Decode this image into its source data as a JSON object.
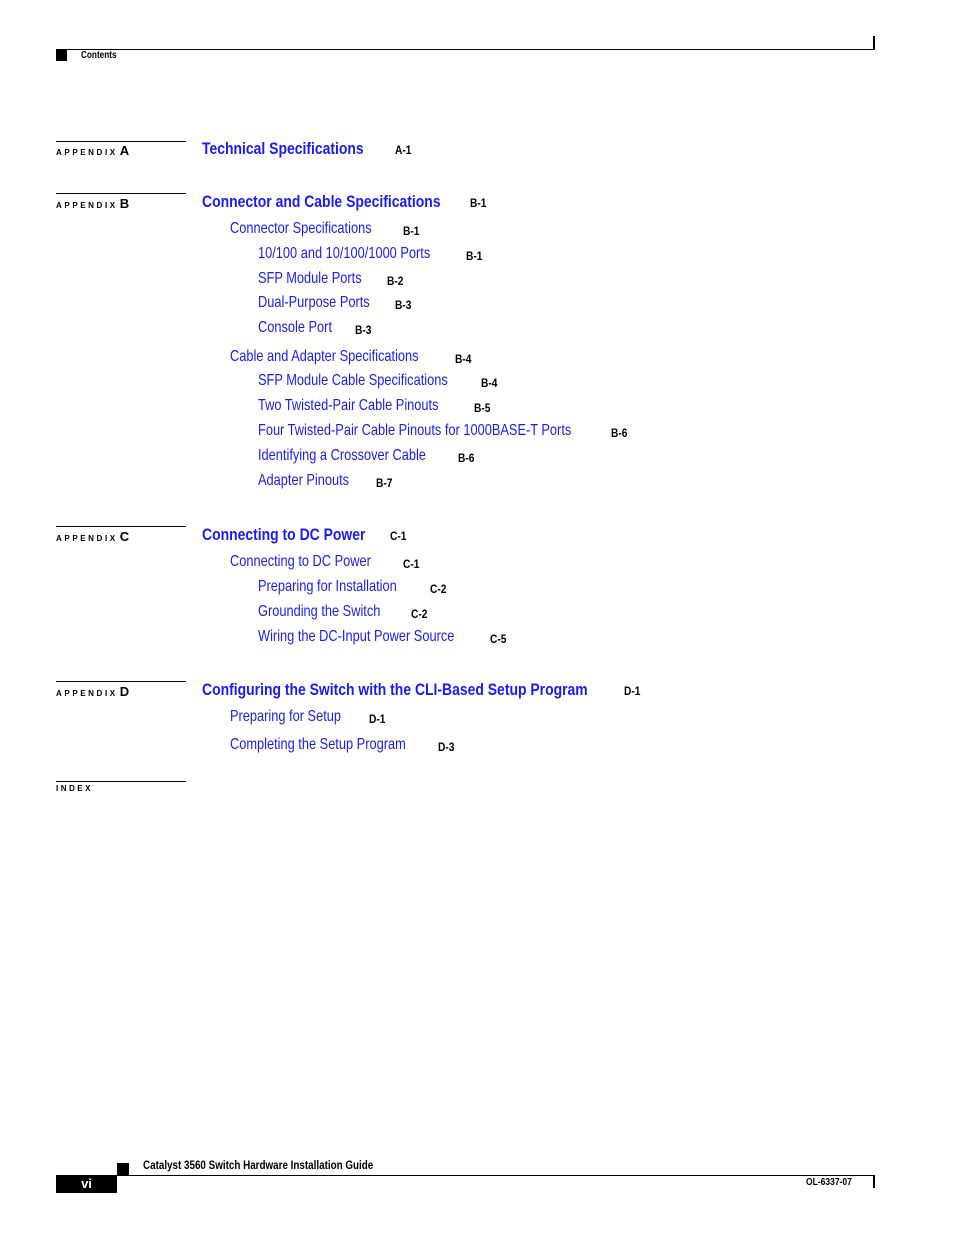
{
  "header": {
    "section": "Contents"
  },
  "colors": {
    "link": "#1a1aff",
    "text": "#000000"
  },
  "appendices": [
    {
      "tag": "APPENDIX",
      "letter": "A",
      "title": "Technical Specifications",
      "page": "A-1",
      "entries": []
    },
    {
      "tag": "APPENDIX",
      "letter": "B",
      "title": "Connector and Cable Specifications",
      "page": "B-1",
      "entries": [
        {
          "level": 2,
          "title": "Connector Specifications",
          "page": "B-1"
        },
        {
          "level": 3,
          "title": "10/100 and 10/100/1000 Ports",
          "page": "B-1"
        },
        {
          "level": 3,
          "title": "SFP Module Ports",
          "page": "B-2"
        },
        {
          "level": 3,
          "title": "Dual-Purpose Ports",
          "page": "B-3"
        },
        {
          "level": 3,
          "title": "Console Port",
          "page": "B-3"
        },
        {
          "level": 2,
          "title": "Cable and Adapter Specifications",
          "page": "B-4"
        },
        {
          "level": 3,
          "title": "SFP Module Cable Specifications",
          "page": "B-4"
        },
        {
          "level": 3,
          "title": "Two Twisted-Pair Cable Pinouts",
          "page": "B-5"
        },
        {
          "level": 3,
          "title": "Four Twisted-Pair Cable Pinouts for 1000BASE-T Ports",
          "page": "B-6"
        },
        {
          "level": 3,
          "title": "Identifying a Crossover Cable",
          "page": "B-6"
        },
        {
          "level": 3,
          "title": "Adapter Pinouts",
          "page": "B-7"
        }
      ]
    },
    {
      "tag": "APPENDIX",
      "letter": "C",
      "title": "Connecting to DC Power",
      "page": "C-1",
      "entries": [
        {
          "level": 2,
          "title": "Connecting to DC Power",
          "page": "C-1"
        },
        {
          "level": 3,
          "title": "Preparing for Installation",
          "page": "C-2"
        },
        {
          "level": 3,
          "title": "Grounding the Switch",
          "page": "C-2"
        },
        {
          "level": 3,
          "title": "Wiring the DC-Input Power Source",
          "page": "C-5"
        }
      ]
    },
    {
      "tag": "APPENDIX",
      "letter": "D",
      "title": "Configuring the Switch with the CLI-Based Setup Program",
      "page": "D-1",
      "entries": [
        {
          "level": 2,
          "title": "Preparing for Setup",
          "page": "D-1"
        },
        {
          "level": 2,
          "title": "Completing the Setup Program",
          "page": "D-3"
        }
      ]
    }
  ],
  "index": {
    "label": "INDEX"
  },
  "footer": {
    "guide_title": "Catalyst 3560 Switch Hardware Installation Guide",
    "page_number": "vi",
    "doc_number": "OL-6337-07"
  }
}
